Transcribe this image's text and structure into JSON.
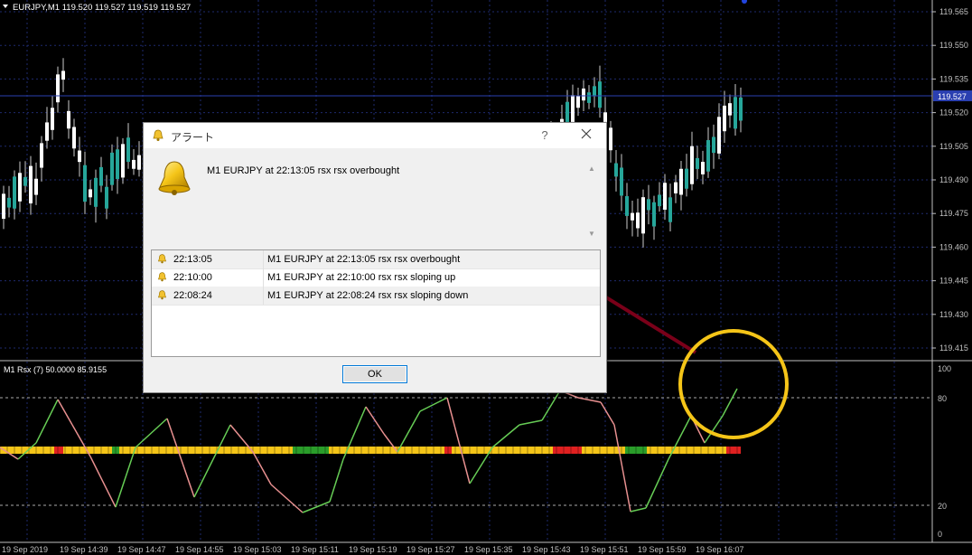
{
  "chart": {
    "header": "EURJPY,M1  119.520 119.527 119.519 119.527",
    "current_price": "119.527",
    "price_labels": [
      "119.565",
      "119.550",
      "119.535",
      "119.520",
      "119.505",
      "119.490",
      "119.475",
      "119.460",
      "119.445",
      "119.430",
      "119.415"
    ],
    "indicator_label": "M1 Rsx (7) 50.0000 85.9155",
    "indicator_levels": [
      "100",
      "80",
      "20",
      "0"
    ],
    "time_labels": [
      "19 Sep 2019",
      "19 Sep 14:39",
      "19 Sep 14:47",
      "19 Sep 14:55",
      "19 Sep 15:03",
      "19 Sep 15:11",
      "19 Sep 15:19",
      "19 Sep 15:27",
      "19 Sep 15:35",
      "19 Sep 15:43",
      "19 Sep 15:51",
      "19 Sep 15:59",
      "19 Sep 16:07"
    ],
    "colors": {
      "bull": "#26a69a",
      "bear": "#ffffff",
      "grid": "#1e2a6e",
      "rsx_up": "#66cc55",
      "rsx_down": "#e89090",
      "axis": "#c0c0c0",
      "annotation_line": "#7a0019",
      "annotation_circle": "#f5c518"
    }
  },
  "dialog": {
    "title": "アラート",
    "help": "?",
    "message": "M1 EURJPY at 22:13:05 rsx  rsx overbought",
    "rows": [
      {
        "time": "22:13:05",
        "text": "M1 EURJPY at 22:13:05 rsx  rsx overbought"
      },
      {
        "time": "22:10:00",
        "text": "M1 EURJPY at 22:10:00 rsx  rsx sloping up"
      },
      {
        "time": "22:08:24",
        "text": "M1 EURJPY at 22:08:24 rsx  rsx sloping down"
      }
    ],
    "ok_label": "OK"
  }
}
